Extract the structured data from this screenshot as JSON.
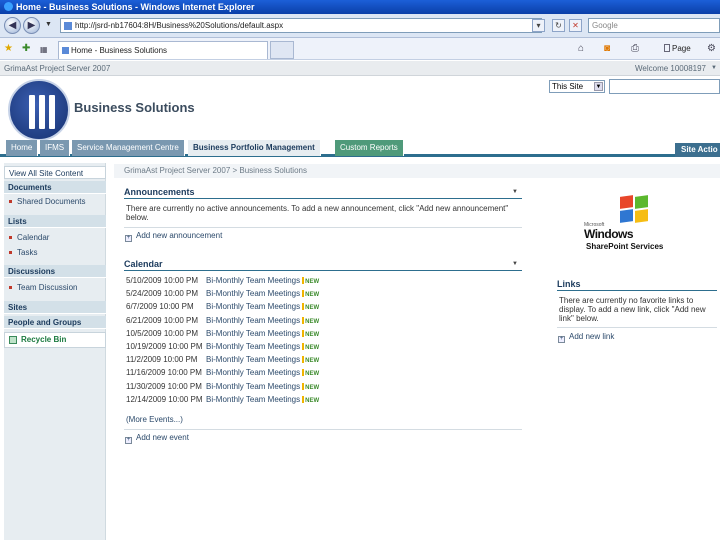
{
  "browser": {
    "title": "Home - Business Solutions - Windows Internet Explorer",
    "address": "http://jsrd-nb17604:8H/Business%20Solutions/default.aspx",
    "search_placeholder": "Google",
    "tab_label": "Home - Business Solutions",
    "page_label": "Page"
  },
  "sp": {
    "server_name": "GrimaAst Project Server 2007",
    "welcome": "Welcome 10008197",
    "site_title": "Business Solutions",
    "search_scope": "This Site",
    "site_actions": "Site Actio"
  },
  "nav": {
    "tabs": [
      "Home",
      "IFMS",
      "Service Management Centre",
      "Business Portfolio Management",
      "Custom Reports"
    ],
    "selected": "Business Portfolio Management"
  },
  "quicklaunch": {
    "view_all": "View All Site Content",
    "documents": "Documents",
    "shared_documents": "Shared Documents",
    "lists": "Lists",
    "calendar": "Calendar",
    "tasks": "Tasks",
    "discussions": "Discussions",
    "team_discussion": "Team Discussion",
    "sites": "Sites",
    "people_groups": "People and Groups",
    "recycle_bin": "Recycle Bin"
  },
  "breadcrumb": "GrimaAst Project Server 2007 > Business Solutions",
  "announcements": {
    "title": "Announcements",
    "empty": "There are currently no active announcements. To add a new announcement, click \"Add new announcement\" below.",
    "add": "Add new announcement"
  },
  "calendar": {
    "title": "Calendar",
    "rows": [
      {
        "date": "5/10/2009 10:00 PM",
        "title": "Bi-Monthly Team Meetings"
      },
      {
        "date": "5/24/2009 10:00 PM",
        "title": "Bi-Monthly Team Meetings"
      },
      {
        "date": "6/7/2009 10:00 PM",
        "title": "Bi-Monthly Team Meetings"
      },
      {
        "date": "6/21/2009 10:00 PM",
        "title": "Bi-Monthly Team Meetings"
      },
      {
        "date": "10/5/2009 10:00 PM",
        "title": "Bi-Monthly Team Meetings"
      },
      {
        "date": "10/19/2009 10:00 PM",
        "title": "Bi-Monthly Team Meetings"
      },
      {
        "date": "11/2/2009 10:00 PM",
        "title": "Bi-Monthly Team Meetings"
      },
      {
        "date": "11/16/2009 10:00 PM",
        "title": "Bi-Monthly Team Meetings"
      },
      {
        "date": "11/30/2009 10:00 PM",
        "title": "Bi-Monthly Team Meetings"
      },
      {
        "date": "12/14/2009 10:00 PM",
        "title": "Bi-Monthly Team Meetings"
      }
    ],
    "new_badge": "NEW",
    "more": "(More Events...)",
    "add": "Add new event"
  },
  "links": {
    "title": "Links",
    "empty": "There are currently no favorite links to display. To add a new link, click \"Add new link\" below.",
    "add": "Add new link"
  },
  "logo": {
    "microsoft": "Microsoft",
    "windows": "Windows",
    "sharepoint": "SharePoint Services"
  }
}
